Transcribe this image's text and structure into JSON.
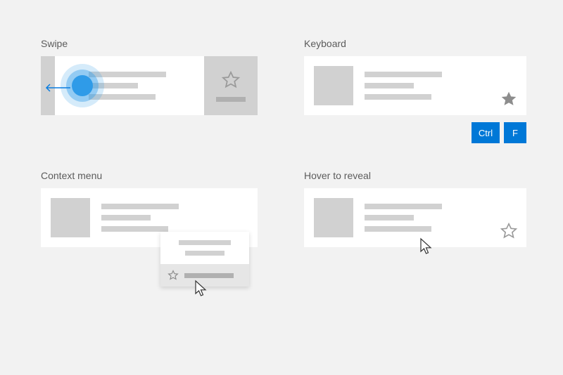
{
  "sections": {
    "swipe": {
      "label": "Swipe"
    },
    "keyboard": {
      "label": "Keyboard",
      "keys": {
        "ctrl": "Ctrl",
        "f": "F"
      }
    },
    "context_menu": {
      "label": "Context menu"
    },
    "hover": {
      "label": "Hover to reveal"
    }
  },
  "icons": {
    "star_outline": "star-outline-icon",
    "star_filled": "star-filled-icon",
    "cursor": "cursor-icon",
    "arrow_left": "arrow-left-icon",
    "touch": "touch-point-icon"
  }
}
